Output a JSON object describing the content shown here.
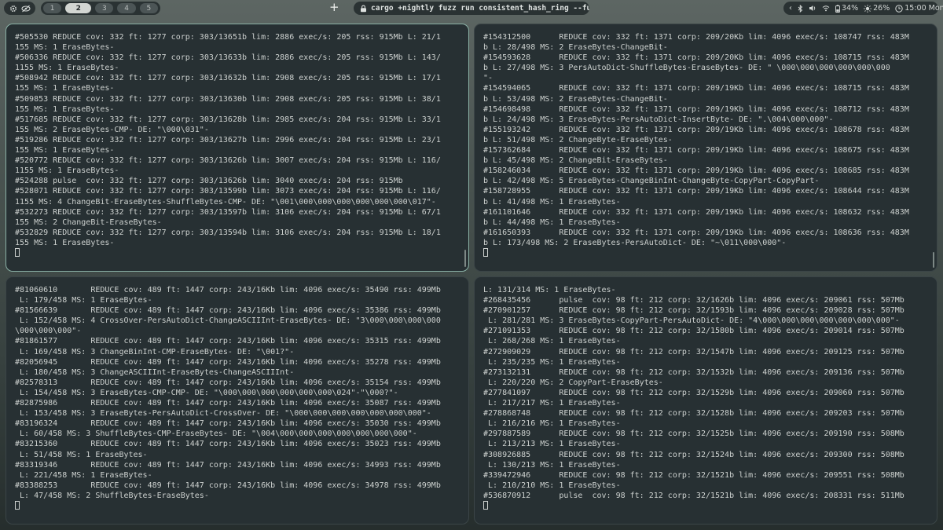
{
  "topbar": {
    "left_icons": [
      "gear-icon",
      "eye-off-icon"
    ],
    "workspaces": [
      "1",
      "2",
      "3",
      "4",
      "5"
    ],
    "active_workspace": "2",
    "window_title": "cargo +nightly fuzz run consistent_hash_ring --fuzz-d…",
    "status": {
      "battery": "34%",
      "brightness": "26%",
      "clock": "15:00 Mon"
    }
  },
  "panes": {
    "top_left": [
      "#505530 REDUCE cov: 332 ft: 1277 corp: 303/13651b lim: 2886 exec/s: 205 rss: 915Mb L: 21/1",
      "155 MS: 1 EraseBytes-",
      "#506336 REDUCE cov: 332 ft: 1277 corp: 303/13633b lim: 2886 exec/s: 205 rss: 915Mb L: 143/",
      "1155 MS: 1 EraseBytes-",
      "#508942 REDUCE cov: 332 ft: 1277 corp: 303/13632b lim: 2908 exec/s: 205 rss: 915Mb L: 17/1",
      "155 MS: 1 EraseBytes-",
      "#509853 REDUCE cov: 332 ft: 1277 corp: 303/13630b lim: 2908 exec/s: 205 rss: 915Mb L: 38/1",
      "155 MS: 1 EraseBytes-",
      "#517685 REDUCE cov: 332 ft: 1277 corp: 303/13628b lim: 2985 exec/s: 204 rss: 915Mb L: 33/1",
      "155 MS: 2 EraseBytes-CMP- DE: \"\\000\\031\"-",
      "#519286 REDUCE cov: 332 ft: 1277 corp: 303/13627b lim: 2996 exec/s: 204 rss: 915Mb L: 23/1",
      "155 MS: 1 EraseBytes-",
      "#520772 REDUCE cov: 332 ft: 1277 corp: 303/13626b lim: 3007 exec/s: 204 rss: 915Mb L: 116/",
      "1155 MS: 1 EraseBytes-",
      "#524288 pulse  cov: 332 ft: 1277 corp: 303/13626b lim: 3040 exec/s: 204 rss: 915Mb",
      "#528071 REDUCE cov: 332 ft: 1277 corp: 303/13599b lim: 3073 exec/s: 204 rss: 915Mb L: 116/",
      "1155 MS: 4 ChangeBit-EraseBytes-ShuffleBytes-CMP- DE: \"\\001\\000\\000\\000\\000\\000\\000\\017\"-",
      "#532273 REDUCE cov: 332 ft: 1277 corp: 303/13597b lim: 3106 exec/s: 204 rss: 915Mb L: 67/1",
      "155 MS: 2 ChangeBit-EraseBytes-",
      "#532829 REDUCE cov: 332 ft: 1277 corp: 303/13594b lim: 3106 exec/s: 204 rss: 915Mb L: 18/1",
      "155 MS: 1 EraseBytes-"
    ],
    "top_right": [
      "#154312500      REDUCE cov: 332 ft: 1371 corp: 209/20Kb lim: 4096 exec/s: 108747 rss: 483M",
      "b L: 28/498 MS: 2 EraseBytes-ChangeBit-",
      "#154593628      REDUCE cov: 332 ft: 1371 corp: 209/20Kb lim: 4096 exec/s: 108715 rss: 483M",
      "b L: 27/498 MS: 3 PersAutoDict-ShuffleBytes-EraseBytes- DE: \" \\000\\000\\000\\000\\000\\000",
      "\"-",
      "#154594065      REDUCE cov: 332 ft: 1371 corp: 209/19Kb lim: 4096 exec/s: 108715 rss: 483M",
      "b L: 53/498 MS: 2 EraseBytes-ChangeBit-",
      "#154698498      REDUCE cov: 332 ft: 1371 corp: 209/19Kb lim: 4096 exec/s: 108712 rss: 483M",
      "b L: 24/498 MS: 3 EraseBytes-PersAutoDict-InsertByte- DE: \".\\004\\000\\000\"-",
      "#155193242      REDUCE cov: 332 ft: 1371 corp: 209/19Kb lim: 4096 exec/s: 108678 rss: 483M",
      "b L: 51/498 MS: 2 ChangeByte-EraseBytes-",
      "#157362684      REDUCE cov: 332 ft: 1371 corp: 209/19Kb lim: 4096 exec/s: 108675 rss: 483M",
      "b L: 45/498 MS: 2 ChangeBit-EraseBytes-",
      "#158246034      REDUCE cov: 332 ft: 1371 corp: 209/19Kb lim: 4096 exec/s: 108685 rss: 483M",
      "b L: 42/498 MS: 5 EraseBytes-ChangeBinInt-ChangeByte-CopyPart-CopyPart-",
      "#158728955      REDUCE cov: 332 ft: 1371 corp: 209/19Kb lim: 4096 exec/s: 108644 rss: 483M",
      "b L: 41/498 MS: 1 EraseBytes-",
      "#161101646      REDUCE cov: 332 ft: 1371 corp: 209/19Kb lim: 4096 exec/s: 108632 rss: 483M",
      "b L: 44/498 MS: 1 EraseBytes-",
      "#161650393      REDUCE cov: 332 ft: 1371 corp: 209/19Kb lim: 4096 exec/s: 108636 rss: 483M",
      "b L: 173/498 MS: 2 EraseBytes-PersAutoDict- DE: \"~\\011\\000\\000\"-"
    ],
    "bottom_left": [
      "#81060610       REDUCE cov: 489 ft: 1447 corp: 243/16Kb lim: 4096 exec/s: 35490 rss: 499Mb",
      " L: 179/458 MS: 1 EraseBytes-",
      "#81566639       REDUCE cov: 489 ft: 1447 corp: 243/16Kb lim: 4096 exec/s: 35386 rss: 499Mb",
      " L: 152/458 MS: 4 CrossOver-PersAutoDict-ChangeASCIIInt-EraseBytes- DE: \"3\\000\\000\\000\\000",
      "\\000\\000\\000\"-",
      "#81861577       REDUCE cov: 489 ft: 1447 corp: 243/16Kb lim: 4096 exec/s: 35315 rss: 499Mb",
      " L: 169/458 MS: 3 ChangeBinInt-CMP-EraseBytes- DE: \"\\001?\"-",
      "#82056945       REDUCE cov: 489 ft: 1447 corp: 243/16Kb lim: 4096 exec/s: 35278 rss: 499Mb",
      " L: 180/458 MS: 3 ChangeASCIIInt-EraseBytes-ChangeASCIIInt-",
      "#82578313       REDUCE cov: 489 ft: 1447 corp: 243/16Kb lim: 4096 exec/s: 35154 rss: 499Mb",
      " L: 154/458 MS: 3 EraseBytes-CMP-CMP- DE: \"\\000\\000\\000\\000\\000\\000\\024\"-\"\\000?\"-",
      "#82875986       REDUCE cov: 489 ft: 1447 corp: 243/16Kb lim: 4096 exec/s: 35087 rss: 499Mb",
      " L: 153/458 MS: 3 EraseBytes-PersAutoDict-CrossOver- DE: \"\\000\\000\\000\\000\\000\\000\\000\"-",
      "#83196324       REDUCE cov: 489 ft: 1447 corp: 243/16Kb lim: 4096 exec/s: 35030 rss: 499Mb",
      " L: 60/458 MS: 3 ShuffleBytes-CMP-EraseBytes- DE: \"\\004\\000\\000\\000\\000\\000\\000\\000\"-",
      "#83215360       REDUCE cov: 489 ft: 1447 corp: 243/16Kb lim: 4096 exec/s: 35023 rss: 499Mb",
      " L: 51/458 MS: 1 EraseBytes-",
      "#83319346       REDUCE cov: 489 ft: 1447 corp: 243/16Kb lim: 4096 exec/s: 34993 rss: 499Mb",
      " L: 221/458 MS: 1 EraseBytes-",
      "#83388253       REDUCE cov: 489 ft: 1447 corp: 243/16Kb lim: 4096 exec/s: 34978 rss: 499Mb",
      " L: 47/458 MS: 2 ShuffleBytes-EraseBytes-"
    ],
    "bottom_right": [
      "L: 131/314 MS: 1 EraseBytes-",
      "#268435456      pulse  cov: 98 ft: 212 corp: 32/1626b lim: 4096 exec/s: 209061 rss: 507Mb",
      "#270901257      REDUCE cov: 98 ft: 212 corp: 32/1593b lim: 4096 exec/s: 209028 rss: 507Mb",
      " L: 281/281 MS: 3 EraseBytes-CopyPart-PersAutoDict- DE: \"4\\000\\000\\000\\000\\000\\000\\000\"-",
      "#271091353      REDUCE cov: 98 ft: 212 corp: 32/1580b lim: 4096 exec/s: 209014 rss: 507Mb",
      " L: 268/268 MS: 1 EraseBytes-",
      "#272909029      REDUCE cov: 98 ft: 212 corp: 32/1547b lim: 4096 exec/s: 209125 rss: 507Mb",
      " L: 235/235 MS: 1 EraseBytes-",
      "#273132131      REDUCE cov: 98 ft: 212 corp: 32/1532b lim: 4096 exec/s: 209136 rss: 507Mb",
      " L: 220/220 MS: 2 CopyPart-EraseBytes-",
      "#277841097      REDUCE cov: 98 ft: 212 corp: 32/1529b lim: 4096 exec/s: 209060 rss: 507Mb",
      " L: 217/217 MS: 1 EraseBytes-",
      "#278868748      REDUCE cov: 98 ft: 212 corp: 32/1528b lim: 4096 exec/s: 209203 rss: 507Mb",
      " L: 216/216 MS: 1 EraseBytes-",
      "#297887589      REDUCE cov: 98 ft: 212 corp: 32/1525b lim: 4096 exec/s: 209190 rss: 508Mb",
      " L: 213/213 MS: 1 EraseBytes-",
      "#308926885      REDUCE cov: 98 ft: 212 corp: 32/1524b lim: 4096 exec/s: 209300 rss: 508Mb",
      " L: 130/213 MS: 1 EraseBytes-",
      "#339472946      REDUCE cov: 98 ft: 212 corp: 32/1521b lim: 4096 exec/s: 209551 rss: 508Mb",
      " L: 210/210 MS: 1 EraseBytes-",
      "#536870912      pulse  cov: 98 ft: 212 corp: 32/1521b lim: 4096 exec/s: 208331 rss: 511Mb"
    ]
  }
}
